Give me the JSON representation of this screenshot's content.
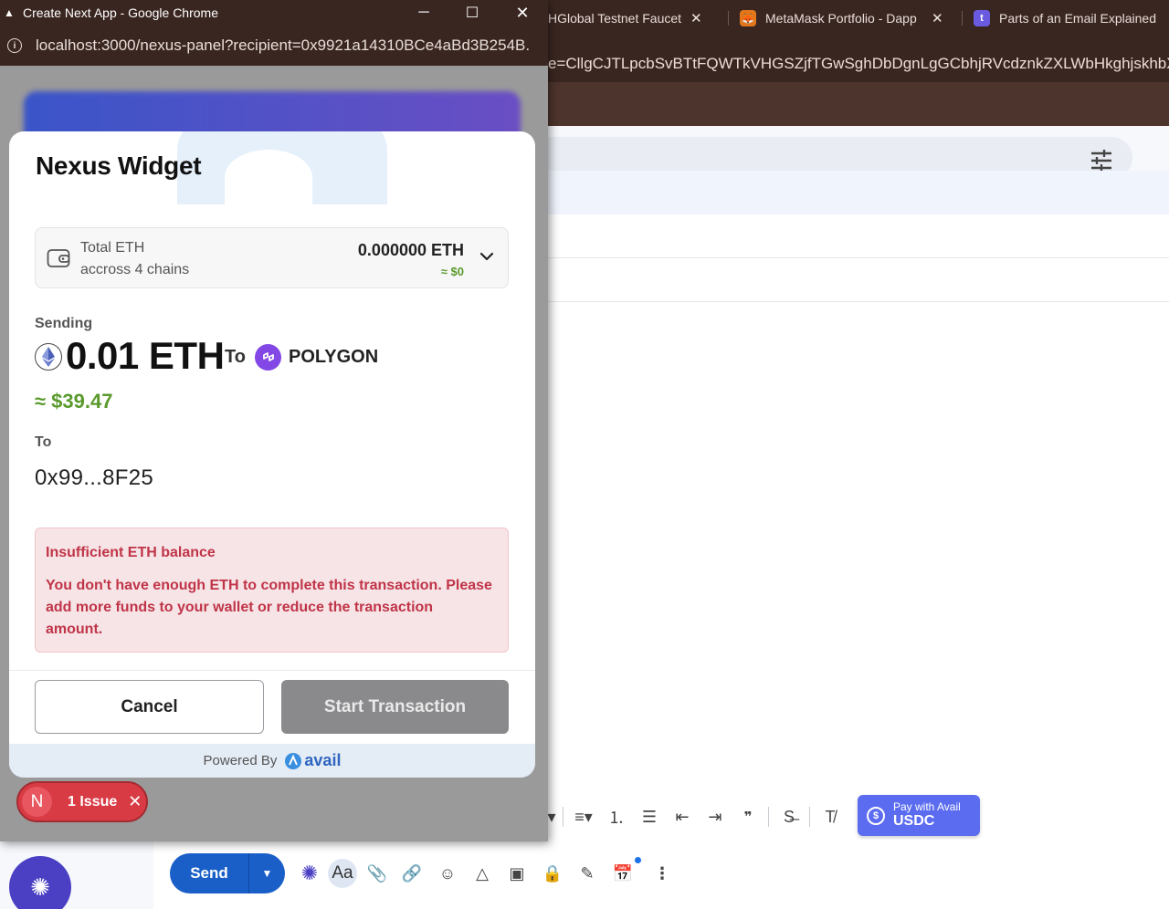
{
  "popup": {
    "window_title": "Create Next App - Google Chrome",
    "url": "localhost:3000/nexus-panel?recipient=0x9921a14310BCe4aBd3B254B..."
  },
  "main_browser": {
    "tabs": [
      {
        "label": "HGlobal Testnet Faucet"
      },
      {
        "label": "MetaMask Portfolio - Dapp"
      },
      {
        "label": "Parts of an Email Explained"
      }
    ],
    "url_fragment": "e=CllgCJTLpcbSvBTtFQWTkVHGSZjfTGwSghDbDgnLgGCbhjRVcdznkZXLWbHkghjskhbXFZPs"
  },
  "widget": {
    "title": "Nexus Widget",
    "balance": {
      "label": "Total ETH",
      "chains_text": "accross 4 chains",
      "amount": "0.000000 ETH",
      "usd": "≈ $0"
    },
    "sending": {
      "label": "Sending",
      "amount": "0.01 ETH",
      "to_word": "To",
      "chain": "POLYGON",
      "usd": "≈ $39.47"
    },
    "recipient": {
      "label": "To",
      "address": "0x99...8F25"
    },
    "error": {
      "title": "Insufficient ETH balance",
      "message": "You don't have enough ETH to complete this transaction. Please add more funds to your wallet or reduce the transaction amount."
    },
    "buttons": {
      "cancel": "Cancel",
      "start": "Start Transaction"
    },
    "powered_by": "Powered By",
    "brand": "avail"
  },
  "issue_badge": {
    "letter": "N",
    "text": "1 Issue"
  },
  "compose": {
    "send_label": "Send",
    "pay_line1": "Pay with Avail",
    "pay_line2": "USDC"
  },
  "colors": {
    "chrome_frame": "#3a2621",
    "success_green": "#5a9a2c",
    "error_red": "#c03448",
    "send_blue": "#1a5fc8",
    "polygon_purple": "#8247e5",
    "avail_button": "#5b6cf0"
  }
}
